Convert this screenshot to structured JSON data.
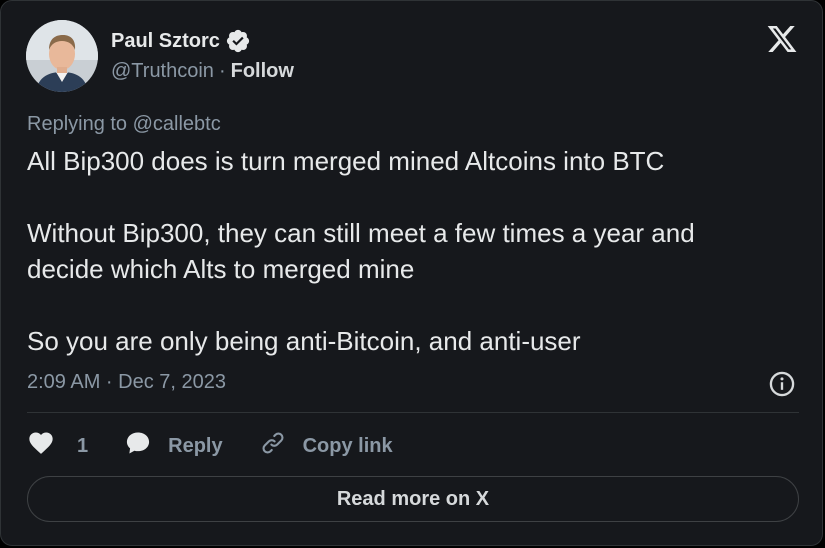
{
  "author": {
    "display_name": "Paul Sztorc",
    "handle": "@Truthcoin",
    "separator": "·",
    "follow_label": "Follow",
    "verified": true
  },
  "tweet": {
    "replying_to": "Replying to @callebtc",
    "paragraphs": [
      "All Bip300 does is turn merged mined Altcoins into BTC",
      "Without Bip300, they can still meet a few times a year and\ndecide which Alts to merged mine",
      "So you are only being anti-Bitcoin, and anti-user"
    ],
    "timestamp": "2:09 AM · Dec 7, 2023"
  },
  "actions": {
    "like_count": "1",
    "reply_label": "Reply",
    "copy_label": "Copy link"
  },
  "footer": {
    "read_more_label": "Read more on X"
  },
  "icons": {
    "brand_logo": "x-logo-icon",
    "verified": "verified-badge-icon",
    "info": "info-icon",
    "like": "heart-icon",
    "reply": "speech-bubble-icon",
    "copy": "link-icon"
  },
  "colors": {
    "background": "#16181c",
    "text_primary": "#e7e9ea",
    "text_secondary": "#8b98a5",
    "border": "#2f3336"
  }
}
